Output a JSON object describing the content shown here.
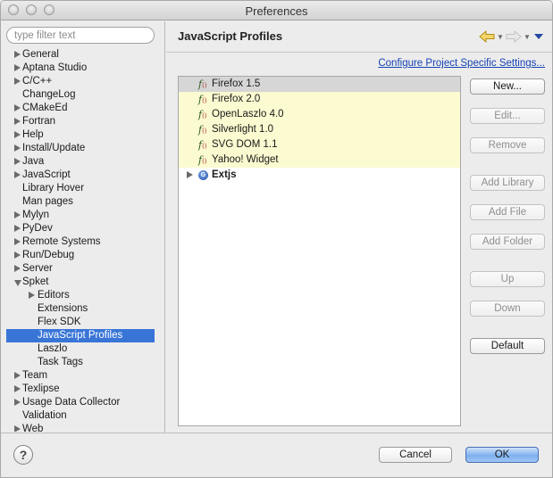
{
  "window": {
    "title": "Preferences"
  },
  "filter": {
    "placeholder": "type filter text"
  },
  "tree": [
    {
      "label": "General",
      "expander": "collapsed"
    },
    {
      "label": "Aptana Studio",
      "expander": "collapsed"
    },
    {
      "label": "C/C++",
      "expander": "collapsed"
    },
    {
      "label": "ChangeLog",
      "expander": "none"
    },
    {
      "label": "CMakeEd",
      "expander": "collapsed"
    },
    {
      "label": "Fortran",
      "expander": "collapsed"
    },
    {
      "label": "Help",
      "expander": "collapsed"
    },
    {
      "label": "Install/Update",
      "expander": "collapsed"
    },
    {
      "label": "Java",
      "expander": "collapsed"
    },
    {
      "label": "JavaScript",
      "expander": "collapsed"
    },
    {
      "label": "Library Hover",
      "expander": "none"
    },
    {
      "label": "Man pages",
      "expander": "none"
    },
    {
      "label": "Mylyn",
      "expander": "collapsed"
    },
    {
      "label": "PyDev",
      "expander": "collapsed"
    },
    {
      "label": "Remote Systems",
      "expander": "collapsed"
    },
    {
      "label": "Run/Debug",
      "expander": "collapsed"
    },
    {
      "label": "Server",
      "expander": "collapsed"
    },
    {
      "label": "Spket",
      "expander": "expanded"
    },
    {
      "label": "Editors",
      "expander": "collapsed",
      "child": true
    },
    {
      "label": "Extensions",
      "expander": "none",
      "child": true
    },
    {
      "label": "Flex SDK",
      "expander": "none",
      "child": true
    },
    {
      "label": "JavaScript Profiles",
      "expander": "none",
      "child": true,
      "selected": true
    },
    {
      "label": "Laszlo",
      "expander": "none",
      "child": true
    },
    {
      "label": "Task Tags",
      "expander": "none",
      "child": true
    },
    {
      "label": "Team",
      "expander": "collapsed"
    },
    {
      "label": "Texlipse",
      "expander": "collapsed"
    },
    {
      "label": "Usage Data Collector",
      "expander": "collapsed"
    },
    {
      "label": "Validation",
      "expander": "none"
    },
    {
      "label": "Web",
      "expander": "collapsed"
    }
  ],
  "page": {
    "title": "JavaScript Profiles",
    "config_link": "Configure Project Specific Settings..."
  },
  "profiles": [
    {
      "name": "Firefox 1.5",
      "icon": "function-icon"
    },
    {
      "name": "Firefox 2.0",
      "icon": "function-icon"
    },
    {
      "name": "OpenLaszlo 4.0",
      "icon": "function-icon"
    },
    {
      "name": "Silverlight 1.0",
      "icon": "function-icon"
    },
    {
      "name": "SVG DOM 1.1",
      "icon": "function-icon"
    },
    {
      "name": "Yahoo! Widget",
      "icon": "function-icon"
    }
  ],
  "group": {
    "name": "Extjs",
    "icon_letter": "G"
  },
  "buttons": {
    "new": "New...",
    "edit": "Edit...",
    "remove": "Remove",
    "add_library": "Add Library",
    "add_file": "Add File",
    "add_folder": "Add Folder",
    "up": "Up",
    "down": "Down",
    "default": "Default"
  },
  "footer": {
    "help": "?",
    "cancel": "Cancel",
    "ok": "OK"
  },
  "colors": {
    "selection": "#3875d7",
    "library_highlight": "#fbfad0",
    "link": "#1542b4"
  }
}
